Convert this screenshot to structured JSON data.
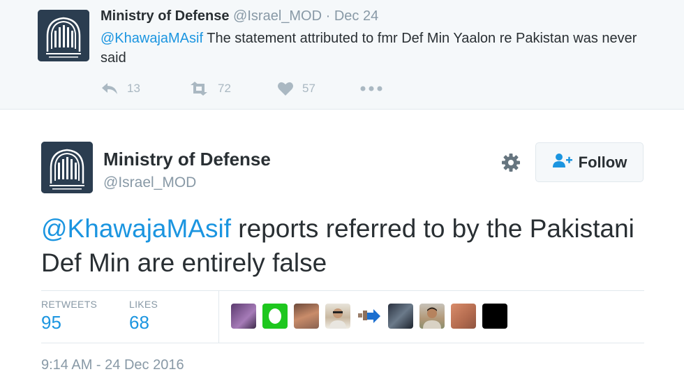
{
  "reply": {
    "name": "Ministry of Defense",
    "handle": "@Israel_MOD",
    "separator": "·",
    "date": "Dec 24",
    "mention": "@KhawajaMAsif",
    "text": " The statement attributed to fmr Def Min Yaalon re Pakistan was never said",
    "reply_count": "13",
    "retweet_count": "72",
    "like_count": "57",
    "icons": [
      "reply-icon",
      "retweet-icon",
      "heart-icon",
      "more-icon"
    ]
  },
  "tweet": {
    "name": "Ministry of Defense",
    "handle": "@Israel_MOD",
    "follow_label": "Follow",
    "mention": "@KhawajaMAsif",
    "text": " reports referred to by the Pakistani Def Min are entirely false",
    "retweets_label": "RETWEETS",
    "retweets_value": "95",
    "likes_label": "LIKES",
    "likes_value": "68",
    "timestamp": "9:14 AM - 24 Dec 2016"
  },
  "colors": {
    "link": "#1b95e0",
    "muted": "#8899a6",
    "text": "#292f33",
    "avatar_bg": "#2b3d50",
    "reply_bg": "#f5f8fa",
    "border": "#e1e8ed"
  }
}
